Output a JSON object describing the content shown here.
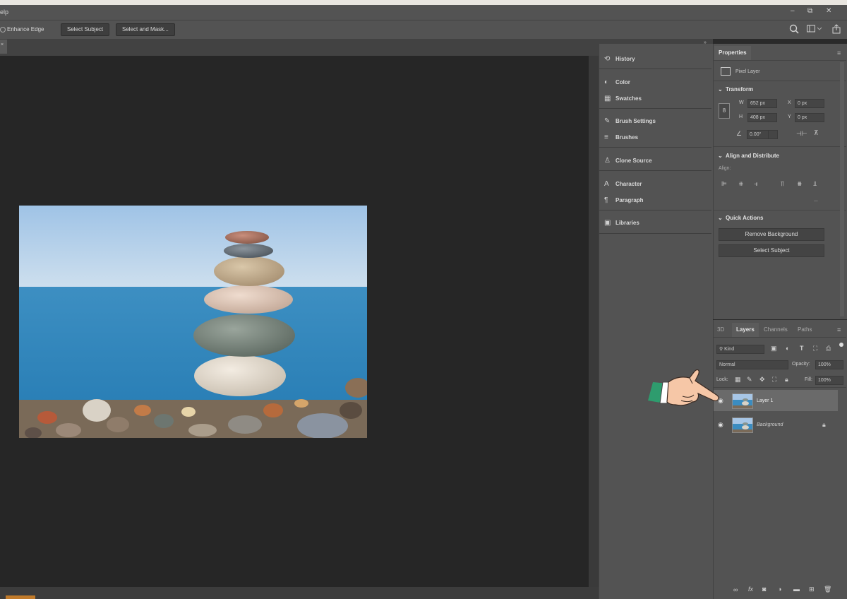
{
  "menubar": {
    "visible_text": "elp",
    "win_min": "–",
    "win_restore": "⧉",
    "win_close": "✕"
  },
  "options_bar": {
    "enhance_edge": "Enhance Edge",
    "select_subject": "Select Subject",
    "select_and_mask": "Select and Mask..."
  },
  "dock": {
    "history": "History",
    "color": "Color",
    "swatches": "Swatches",
    "brush_settings": "Brush Settings",
    "brushes": "Brushes",
    "clone_source": "Clone Source",
    "character": "Character",
    "paragraph": "Paragraph",
    "libraries": "Libraries"
  },
  "properties": {
    "tab": "Properties",
    "layer_type": "Pixel Layer",
    "transform": {
      "title": "Transform",
      "w_label": "W",
      "w_value": "652 px",
      "h_label": "H",
      "h_value": "408 px",
      "x_label": "X",
      "x_value": "0 px",
      "y_label": "Y",
      "y_value": "0 px",
      "angle_value": "0.00°"
    },
    "align": {
      "title": "Align and Distribute",
      "subtitle": "Align:",
      "more": "..."
    },
    "quick_actions": {
      "title": "Quick Actions",
      "remove_bg": "Remove Background",
      "select_subject": "Select Subject"
    }
  },
  "layers_panel": {
    "tabs": [
      "3D",
      "Layers",
      "Channels",
      "Paths"
    ],
    "filter_kind": "Kind",
    "blend_mode": "Normal",
    "opacity_label": "Opacity:",
    "opacity_value": "100%",
    "lock_label": "Lock:",
    "fill_label": "Fill:",
    "fill_value": "100%",
    "layers": [
      {
        "name": "Layer 1",
        "selected": true
      },
      {
        "name": "Background",
        "locked": true
      }
    ]
  },
  "colors": {
    "panel_bg": "#535353",
    "canvas_bg": "#262626",
    "hand_sleeve": "#2e9c6e",
    "hand_skin": "#f6c7a7"
  },
  "icons": [
    "search-icon",
    "workspace-icon",
    "share-icon",
    "history-icon",
    "color-icon",
    "swatches-icon",
    "brush-settings-icon",
    "brushes-icon",
    "clone-source-icon",
    "character-icon",
    "paragraph-icon",
    "libraries-icon",
    "eye-icon",
    "lock-icon",
    "pointing-hand-icon"
  ]
}
